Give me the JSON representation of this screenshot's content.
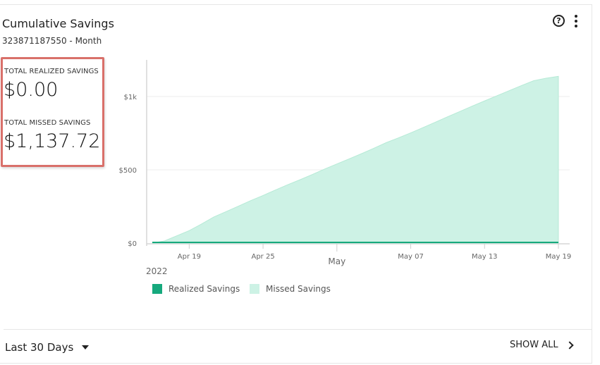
{
  "widget": {
    "title": "Cumulative Savings",
    "subtitle": "323871187550 - Month",
    "help_icon": "question-circle-icon",
    "menu_icon": "vertical-dots-icon"
  },
  "totals": {
    "realized_label": "TOTAL REALIZED SAVINGS",
    "realized_value": "$0.00",
    "missed_label": "TOTAL MISSED SAVINGS",
    "missed_value": "$1,137.72"
  },
  "colors": {
    "realized": "#16a97d",
    "missed_fill": "#cdf2e5",
    "missed_line": "#b6ead6",
    "highlight_border": "#d9706a"
  },
  "chart_data": {
    "type": "area",
    "x": [
      "2022-04-16",
      "2022-04-17",
      "2022-04-18",
      "2022-04-19",
      "2022-04-20",
      "2022-04-21",
      "2022-04-22",
      "2022-04-23",
      "2022-04-24",
      "2022-04-25",
      "2022-04-26",
      "2022-04-27",
      "2022-04-28",
      "2022-04-29",
      "2022-04-30",
      "2022-05-01",
      "2022-05-02",
      "2022-05-03",
      "2022-05-04",
      "2022-05-05",
      "2022-05-06",
      "2022-05-07",
      "2022-05-08",
      "2022-05-09",
      "2022-05-10",
      "2022-05-11",
      "2022-05-12",
      "2022-05-13",
      "2022-05-14",
      "2022-05-15",
      "2022-05-16",
      "2022-05-17",
      "2022-05-18",
      "2022-05-19"
    ],
    "series": [
      {
        "name": "Realized Savings",
        "values": [
          0,
          0,
          0,
          0,
          0,
          0,
          0,
          0,
          0,
          0,
          0,
          0,
          0,
          0,
          0,
          0,
          0,
          0,
          0,
          0,
          0,
          0,
          0,
          0,
          0,
          0,
          0,
          0,
          0,
          0,
          0,
          0,
          0,
          0
        ]
      },
      {
        "name": "Missed Savings",
        "values": [
          0,
          15,
          50,
          85,
          130,
          178,
          215,
          252,
          290,
          325,
          362,
          398,
          432,
          468,
          505,
          540,
          575,
          610,
          647,
          685,
          718,
          752,
          788,
          825,
          862,
          898,
          935,
          970,
          1005,
          1040,
          1075,
          1108,
          1125,
          1137.72
        ]
      }
    ],
    "x_tick_labels": [
      "Apr 19",
      "Apr 25",
      "May",
      "May 07",
      "May 13",
      "May 19"
    ],
    "x_year_label": "2022",
    "y_tick_labels": [
      "$0",
      "$500",
      "$1k"
    ],
    "ylim": [
      0,
      1250
    ],
    "grid": true,
    "legend_position": "bottom-left"
  },
  "legend": [
    {
      "label": "Realized Savings"
    },
    {
      "label": "Missed Savings"
    }
  ],
  "footer": {
    "range_label": "Last 30 Days",
    "show_all_label": "SHOW ALL"
  }
}
